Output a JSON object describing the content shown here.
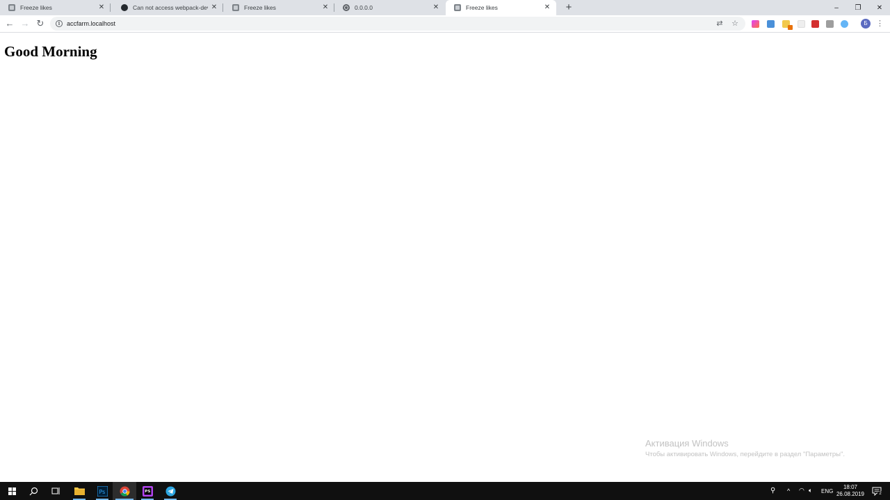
{
  "tabs": [
    {
      "title": "Freeze likes",
      "icon": "site-logo-icon",
      "active": false
    },
    {
      "title": "Can not access webpack-dev-server",
      "icon": "github-icon",
      "active": false
    },
    {
      "title": "Freeze likes",
      "icon": "site-logo-icon",
      "active": false
    },
    {
      "title": "0.0.0.0",
      "icon": "globe-icon",
      "active": false
    },
    {
      "title": "Freeze likes",
      "icon": "site-logo-icon",
      "active": true
    }
  ],
  "window_controls": {
    "minimize": "–",
    "restore": "❐",
    "close": "✕"
  },
  "toolbar": {
    "url": "accfarm.localhost",
    "profile_initial": "Б"
  },
  "page": {
    "greeting": "Good Morning"
  },
  "watermark": {
    "line1": "Активация Windows",
    "line2": "Чтобы активировать Windows, перейдите в раздел \"Параметры\"."
  },
  "taskbar": {
    "language": "ENG",
    "time": "18:07",
    "date": "26.08.2019",
    "notification_count": "2"
  },
  "colors": {
    "tabstrip": "#dee1e6",
    "omnibox": "#f1f3f4",
    "taskbar": "#101010",
    "taskbar_accent": "#76b9ed"
  }
}
